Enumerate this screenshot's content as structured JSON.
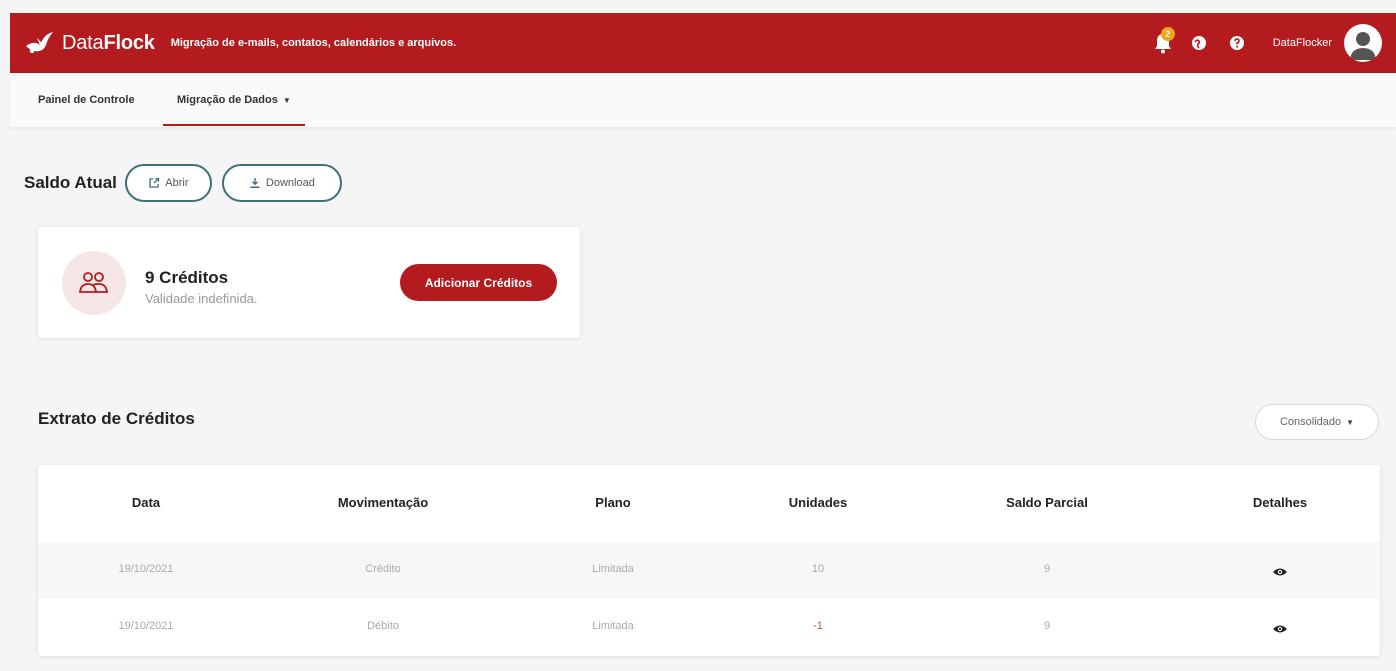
{
  "app": {
    "brand_light": "Data",
    "brand_bold": "Flock",
    "tagline": "Migração de e-mails, contatos, calendários e arquivos.",
    "notification_count": "2",
    "username": "DataFlocker"
  },
  "colors": {
    "brand_red": "#b31b1f",
    "badge_orange": "#f4a21b",
    "outline_teal": "#3f6f7c",
    "negative_red": "#d0454a"
  },
  "nav": {
    "items": [
      {
        "label": "Painel de Controle"
      },
      {
        "label": "Migração de Dados",
        "dropdown": true
      }
    ]
  },
  "balance": {
    "title": "Saldo Atual",
    "open_label": "Abrir",
    "download_label": "Download",
    "credits": "9 Créditos",
    "validity": "Validade indefinida.",
    "add_button": "Adicionar Créditos"
  },
  "statement": {
    "title": "Extrato de Créditos",
    "filter": "Consolidado",
    "columns": [
      "Data",
      "Movimentação",
      "Plano",
      "Unidades",
      "Saldo Parcial",
      "Detalhes"
    ],
    "rows": [
      {
        "date": "19/10/2021",
        "movement": "Crédito",
        "plan": "Limitada",
        "units": "10",
        "partial_balance": "9",
        "details_icon": "eye-icon"
      },
      {
        "date": "19/10/2021",
        "movement": "Débito",
        "plan": "Limitada",
        "units": "-1",
        "partial_balance": "9",
        "details_icon": "eye-icon"
      }
    ]
  }
}
